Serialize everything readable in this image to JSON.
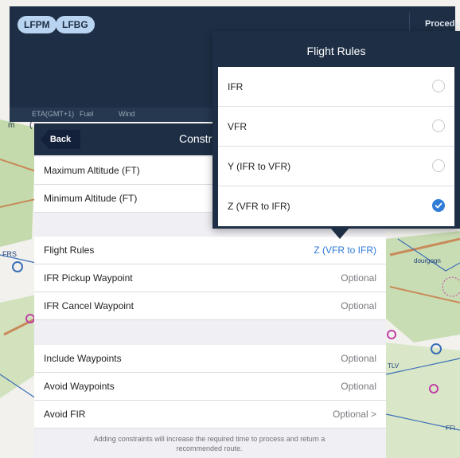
{
  "header": {
    "airports": [
      "LFPM",
      "LFBG"
    ],
    "procedures_label": "Procedur",
    "subbar": [
      "ETA(GMT+1)",
      "Fuel",
      "Wind"
    ],
    "left_fragments": [
      "m",
      "("
    ]
  },
  "map": {
    "labels": [
      "FRS",
      "dourgogn",
      "TLV",
      "FFI"
    ],
    "colors": {
      "land": "#f2f1ee",
      "green": "#b8d49b",
      "brown": "#c98a5a",
      "blue": "#3b6fb7",
      "magenta": "#c23fa6"
    }
  },
  "sheet": {
    "back_label": "Back",
    "title": "Constr",
    "rows_group1": [
      {
        "label": "Maximum Altitude (FT)",
        "value": ""
      },
      {
        "label": "Minimum Altitude (FT)",
        "value": ""
      }
    ],
    "rows_group2": [
      {
        "label": "Flight Rules",
        "value": "Z (VFR to IFR)"
      },
      {
        "label": "IFR Pickup Waypoint",
        "value": "Optional"
      },
      {
        "label": "IFR Cancel Waypoint",
        "value": "Optional"
      }
    ],
    "rows_group3": [
      {
        "label": "Include Waypoints",
        "value": "Optional"
      },
      {
        "label": "Avoid Waypoints",
        "value": "Optional"
      },
      {
        "label": "Avoid FIR",
        "value": "Optional >"
      }
    ],
    "footnote_line1": "Adding constraints will increase the required time to process and return a",
    "footnote_line2": "recommended route."
  },
  "flight_rules_popover": {
    "title": "Flight Rules",
    "options": [
      {
        "label": "IFR",
        "selected": false
      },
      {
        "label": "VFR",
        "selected": false
      },
      {
        "label": "Y (IFR to VFR)",
        "selected": false
      },
      {
        "label": "Z (VFR to IFR)",
        "selected": true
      }
    ],
    "accent": "#2f7bd8"
  }
}
